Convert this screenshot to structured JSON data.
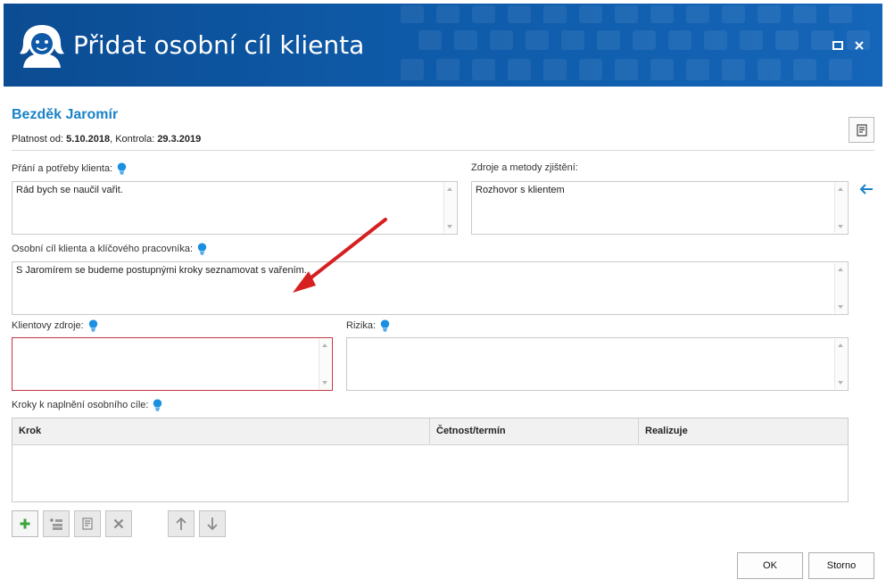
{
  "window": {
    "title": "Přidat osobní cíl klienta",
    "icons": {
      "app": "client-avatar-icon",
      "maximize": "maximize-icon",
      "close": "close-icon"
    },
    "colors": {
      "titlebar": "#0e5aa8",
      "accent": "#1b83c8",
      "error_border": "#c8353f"
    }
  },
  "client": {
    "name": "Bezděk Jaromír",
    "validity_label": "Platnost od:",
    "validity_value": "5.10.2018",
    "control_label": "Kontrola:",
    "control_value": "29.3.2019"
  },
  "fields": {
    "wishes": {
      "label": "Přání a potřeby klienta:",
      "value": "Rád bych se naučil vařit."
    },
    "sources": {
      "label": "Zdroje a metody zjištění:",
      "value": "Rozhovor s klientem"
    },
    "goal": {
      "label": "Osobní cíl klienta a klíčového pracovníka:",
      "value": "S Jaromírem se budeme postupnými kroky seznamovat s vařením."
    },
    "resources": {
      "label": "Klientovy zdroje:",
      "value": ""
    },
    "risks": {
      "label": "Rizika:",
      "value": ""
    },
    "steps": {
      "label": "Kroky k naplnění osobního cíle:"
    }
  },
  "steps_table": {
    "columns": [
      "Krok",
      "Četnost/termín",
      "Realizuje"
    ],
    "rows": []
  },
  "toolbar": {
    "add": "add-icon",
    "add_sub": "add-substep-icon",
    "edit": "edit-icon",
    "delete": "delete-icon",
    "move_up": "arrow-up-icon",
    "move_down": "arrow-down-icon"
  },
  "buttons": {
    "ok": "OK",
    "cancel": "Storno"
  }
}
